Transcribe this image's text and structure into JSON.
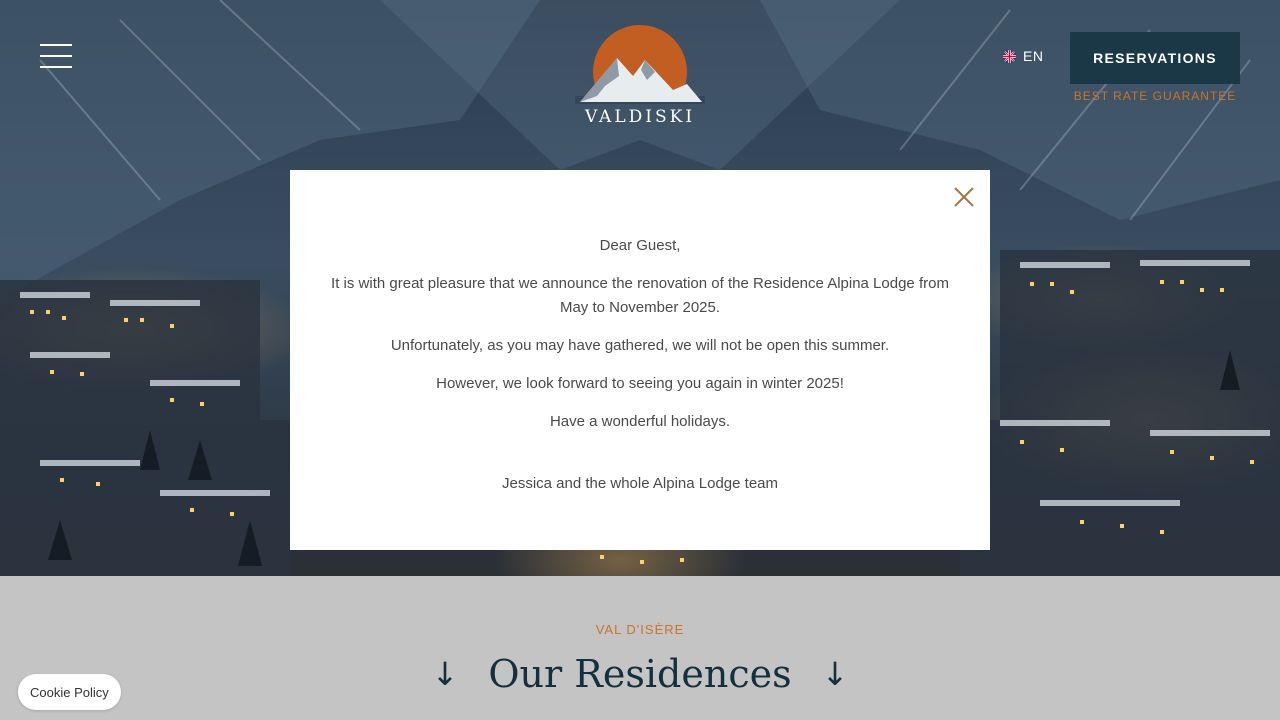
{
  "header": {
    "logo_text": "VALDISKI",
    "language": "EN",
    "reservations_label": "RESERVATIONS",
    "rate_guarantee": "BEST RATE GUARANTEE"
  },
  "modal": {
    "greeting": "Dear Guest,",
    "line1": "It is with great pleasure that we announce the renovation of the Residence Alpina Lodge from May to November 2025.",
    "line2": "Unfortunately, as you may have gathered, we will not be open this summer.",
    "line3": "However, we look forward to seeing you again in winter 2025!",
    "line4": "Have a wonderful holidays.",
    "signature": "Jessica and the whole Alpina Lodge team"
  },
  "section": {
    "subtitle": "VAL D'ISÈRE",
    "title": "Our Residences",
    "arrow_left": "↓",
    "arrow_right": "↓"
  },
  "cookie_label": "Cookie Policy",
  "colors": {
    "accent": "#c8742a",
    "dark": "#1a3845",
    "title": "#12303d"
  }
}
